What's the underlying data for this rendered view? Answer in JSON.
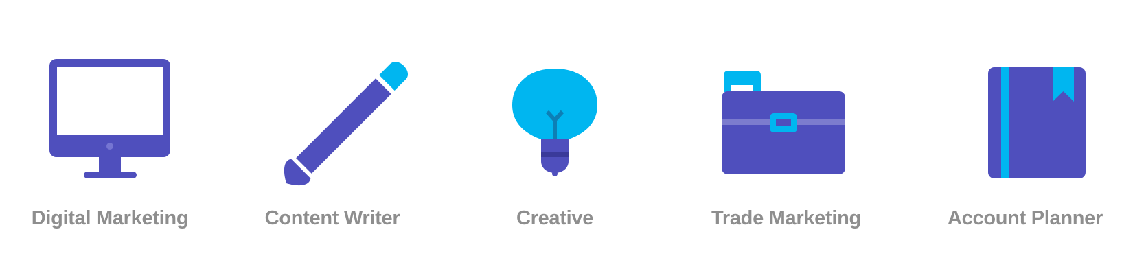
{
  "colors": {
    "primary": "#4f4fbd",
    "accent": "#00b6f0",
    "text": "#8e8e8e"
  },
  "roles": [
    {
      "icon": "monitor-icon",
      "label": "Digital Marketing"
    },
    {
      "icon": "pencil-icon",
      "label": "Content Writer"
    },
    {
      "icon": "lightbulb-icon",
      "label": "Creative"
    },
    {
      "icon": "briefcase-icon",
      "label": "Trade Marketing"
    },
    {
      "icon": "notebook-icon",
      "label": "Account Planner"
    }
  ]
}
